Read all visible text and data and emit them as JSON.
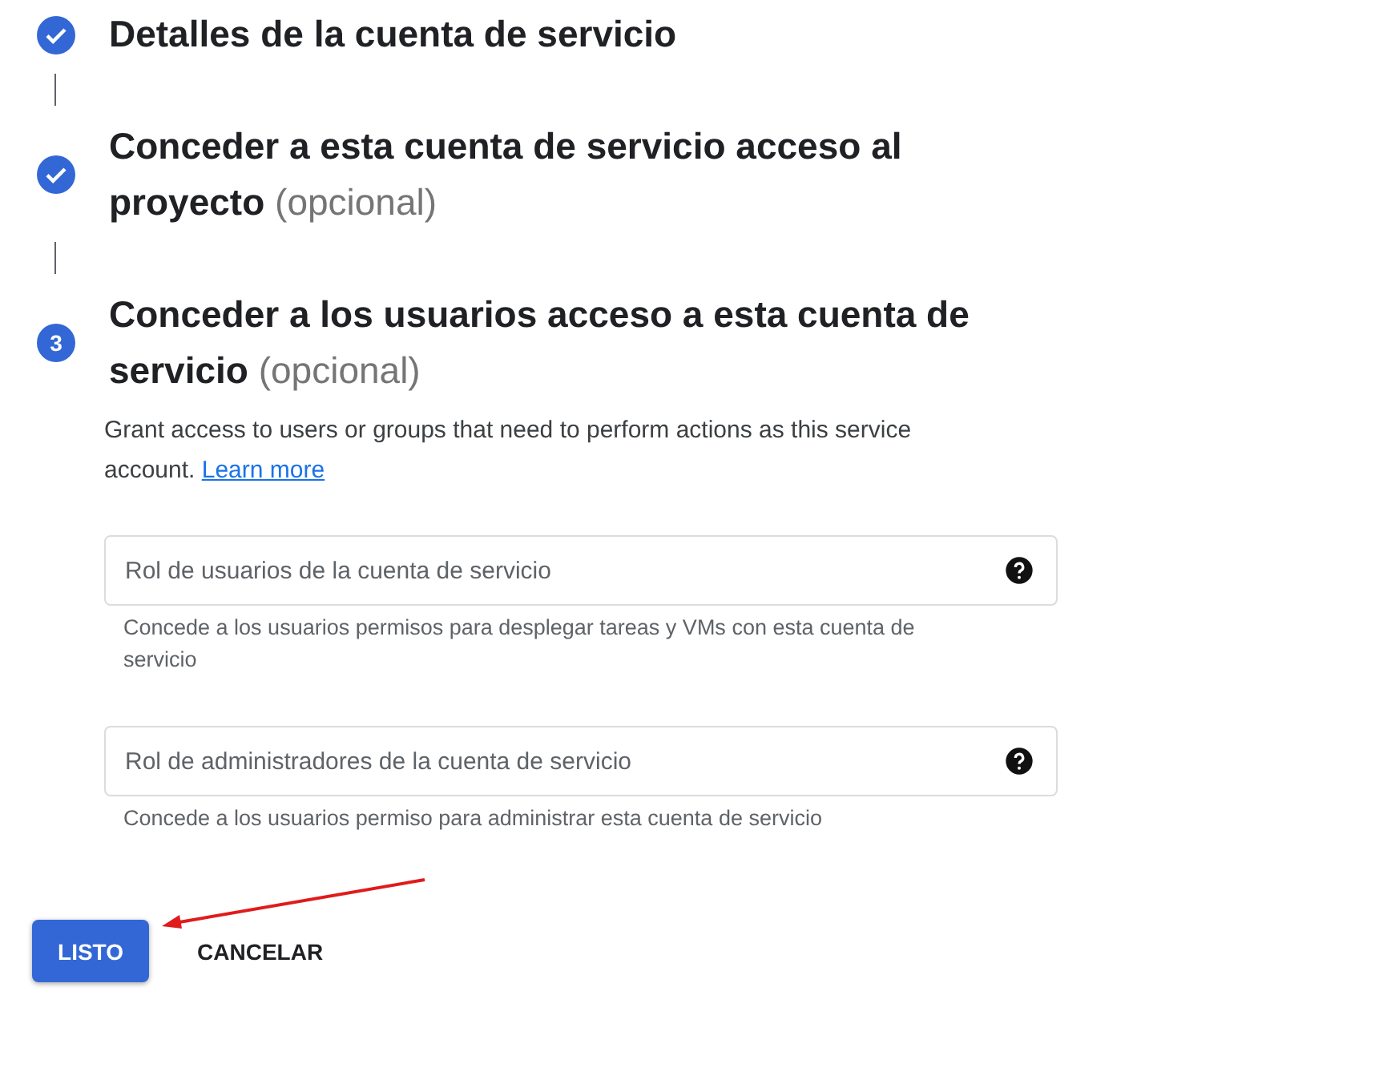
{
  "steps": [
    {
      "kind": "done",
      "title": "Detalles de la cuenta de servicio"
    },
    {
      "kind": "done",
      "title": "Conceder a esta cuenta de servicio acceso al proyecto",
      "optional": "(opcional)"
    },
    {
      "kind": "current",
      "number": "3",
      "title": "Conceder a los usuarios acceso a esta cuenta de servicio",
      "optional": "(opcional)",
      "description": "Grant access to users or groups that need to perform actions as this service account.",
      "link": "Learn more",
      "fields": [
        {
          "placeholder": "Rol de usuarios de la cuenta de servicio",
          "hint": "Concede a los usuarios permisos para desplegar tareas y VMs con esta cuenta de servicio"
        },
        {
          "placeholder": "Rol de administradores de la cuenta de servicio",
          "hint": "Concede a los usuarios permiso para administrar esta cuenta de servicio"
        }
      ]
    }
  ],
  "buttons": [
    {
      "label": "LISTO",
      "kind": "primary"
    },
    {
      "label": "CANCELAR",
      "kind": "text"
    }
  ],
  "annotation": {
    "kind": "arrow"
  }
}
